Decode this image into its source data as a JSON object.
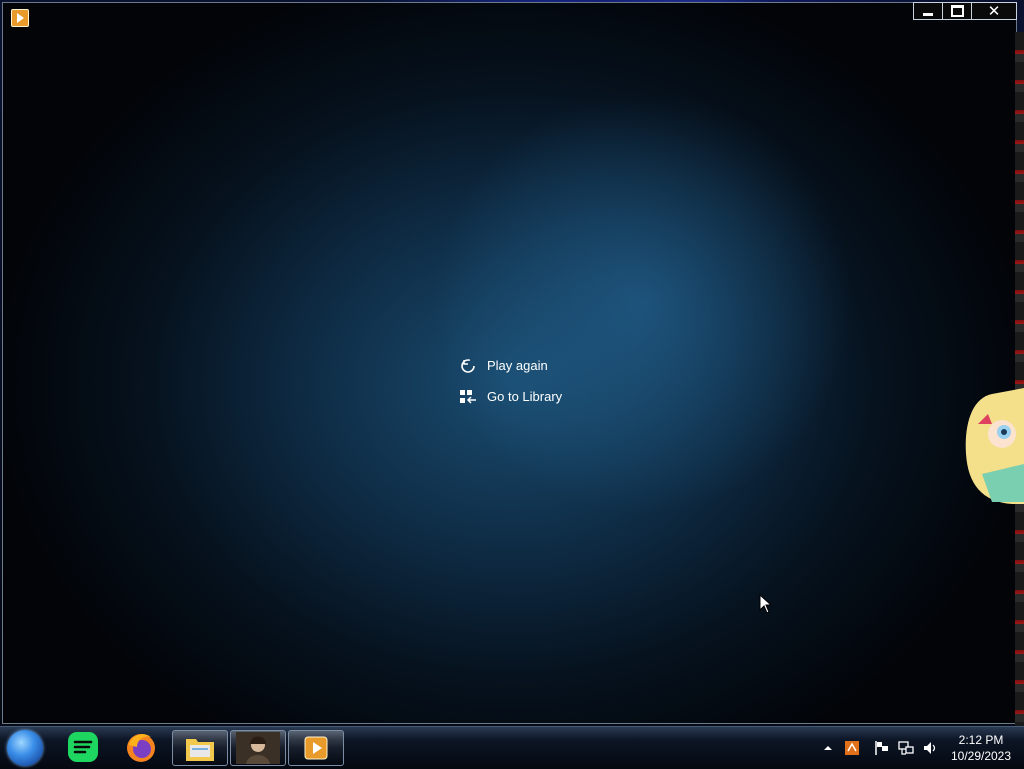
{
  "desktop": {
    "icons": [
      "terminal-icon",
      "firefox-icon",
      "vlc-icon",
      "hyd-icon",
      "image-viewer-icon",
      "avatar-icon"
    ]
  },
  "window": {
    "title_controls": {
      "minimize": "minimize",
      "maximize": "maximize",
      "close": "close"
    },
    "menu": {
      "play_again_label": "Play again",
      "go_to_library_label": "Go to Library"
    }
  },
  "taskbar": {
    "pinned": [
      "start-orb",
      "spotify-icon",
      "firefox-icon",
      "file-explorer-icon",
      "portrait-app-icon",
      "media-player-icon"
    ],
    "clock": {
      "time": "2:12 PM",
      "date": "10/29/2023"
    }
  },
  "colors": {
    "accent": "#3a8ee8",
    "window_bg_center": "#1a4c70",
    "text": "#ffffff",
    "spotify_green": "#1ed760",
    "media_orange": "#e89b2a"
  }
}
